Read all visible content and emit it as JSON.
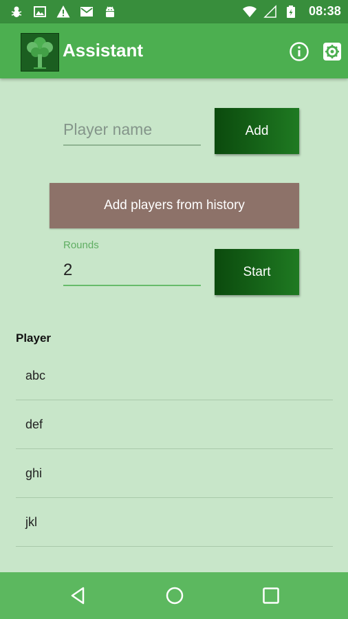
{
  "status_bar": {
    "time": "08:38",
    "left_icons": [
      "bug-icon",
      "image-icon",
      "warning-icon",
      "mail-icon",
      "android-icon"
    ],
    "right_icons": [
      "wifi-icon",
      "signal-icon",
      "battery-icon"
    ]
  },
  "app_bar": {
    "title": "Assistant",
    "icons": [
      "tree-logo-icon",
      "info-icon",
      "settings-icon"
    ]
  },
  "add_player": {
    "name_placeholder": "Player name",
    "name_value": "",
    "add_label": "Add"
  },
  "history": {
    "button_label": "Add players from history"
  },
  "rounds": {
    "label": "Rounds",
    "value": "2",
    "start_label": "Start"
  },
  "players": {
    "header": "Player",
    "items": [
      "abc",
      "def",
      "ghi",
      "jkl"
    ]
  },
  "nav_bar": {
    "icons": [
      "back-icon",
      "home-icon",
      "recent-apps-icon"
    ]
  },
  "colors": {
    "background": "#c8e6c9",
    "app_bar": "#4caf50",
    "status_bar": "#388e3c",
    "button_green": "#1b5e20",
    "history_button": "#8d7269",
    "accent_label": "#5fae62"
  }
}
